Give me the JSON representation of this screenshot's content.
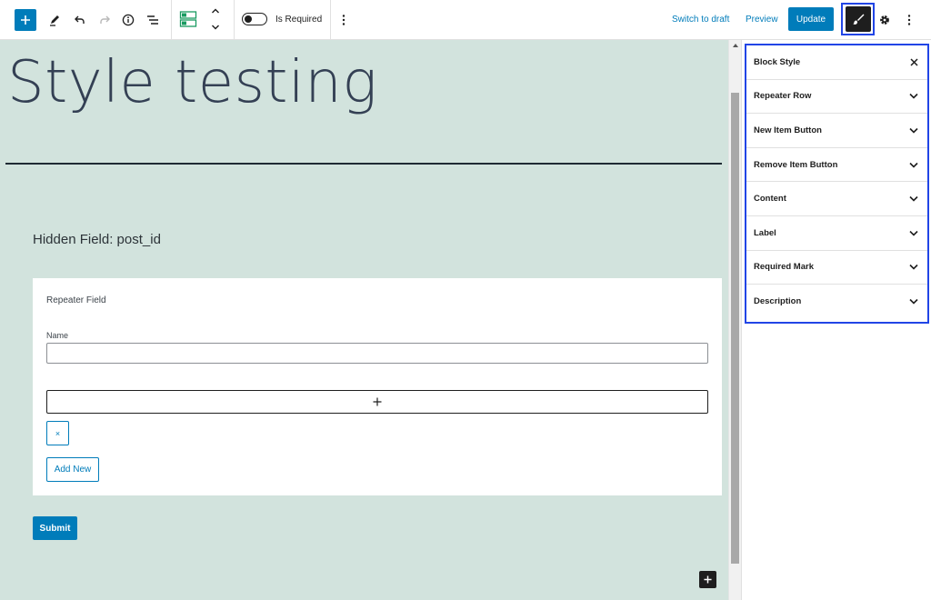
{
  "toolbar": {
    "is_required_label": "Is Required",
    "switch_to_draft_label": "Switch to draft",
    "preview_label": "Preview",
    "update_label": "Update"
  },
  "editor": {
    "title": "Style testing",
    "hidden_field_text": "Hidden Field: post_id",
    "repeater": {
      "title": "Repeater Field",
      "name_label": "Name",
      "name_value": "",
      "remove_label": "×",
      "add_new_label": "Add New"
    },
    "submit_label": "Submit"
  },
  "sidebar": {
    "items": [
      {
        "label": "Block Style",
        "icon": "close-icon"
      },
      {
        "label": "Repeater Row",
        "icon": "chevron-down-icon"
      },
      {
        "label": "New Item Button",
        "icon": "chevron-down-icon"
      },
      {
        "label": "Remove Item Button",
        "icon": "chevron-down-icon"
      },
      {
        "label": "Content",
        "icon": "chevron-down-icon"
      },
      {
        "label": "Label",
        "icon": "chevron-down-icon"
      },
      {
        "label": "Required Mark",
        "icon": "chevron-down-icon"
      },
      {
        "label": "Description",
        "icon": "chevron-down-icon"
      }
    ]
  },
  "colors": {
    "accent": "#007cba",
    "highlight": "#2145e6",
    "canvas": "#d2e3dd"
  }
}
